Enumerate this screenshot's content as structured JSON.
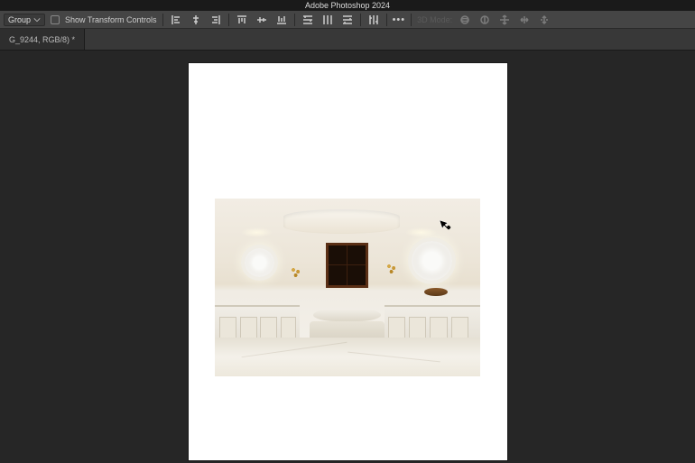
{
  "app": {
    "title": "Adobe Photoshop 2024"
  },
  "options": {
    "selection_mode": "Group",
    "show_transform_label": "Show Transform Controls",
    "mode3d_label": "3D Mode:"
  },
  "document": {
    "tab_label": "G_9244, RGB/8) *"
  }
}
